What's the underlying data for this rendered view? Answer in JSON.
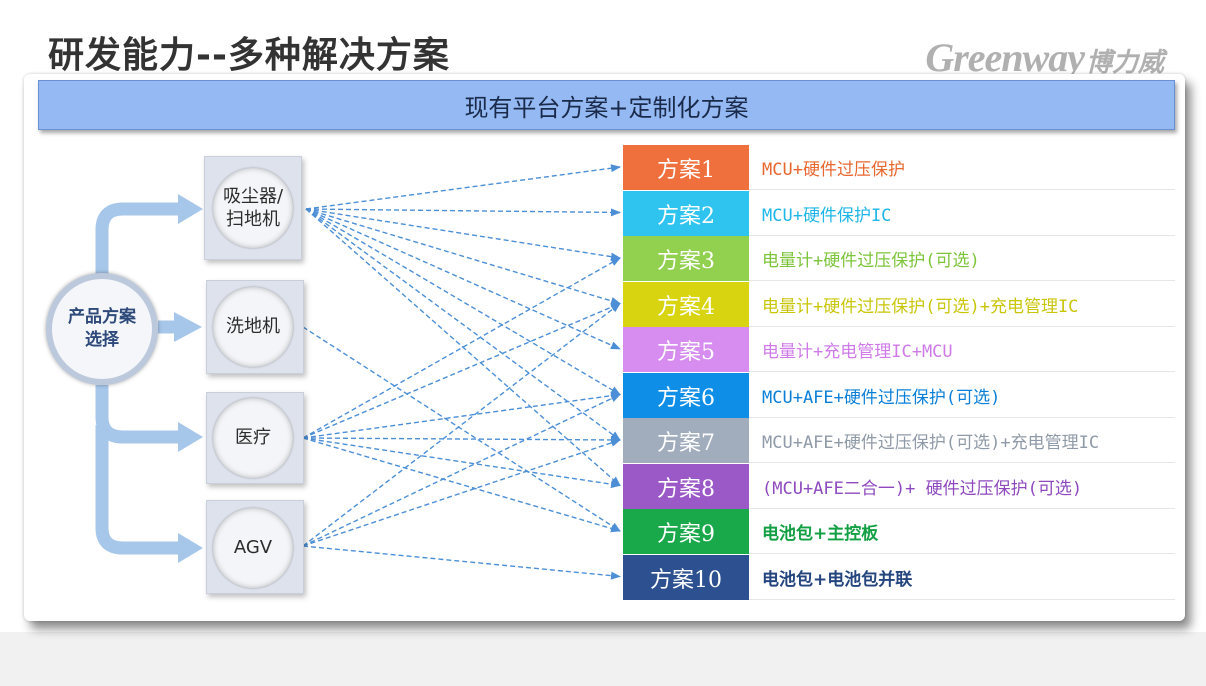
{
  "header": {
    "title": "研发能力--多种解决方案",
    "logo_latin": "Greenway",
    "logo_cn": "博力威"
  },
  "banner": {
    "text": "现有平台方案+定制化方案"
  },
  "root": {
    "line1": "产品方案",
    "line2": "选择"
  },
  "products": [
    {
      "id": "vacuum",
      "line1": "吸尘器/",
      "line2": "扫地机"
    },
    {
      "id": "floor-washer",
      "line1": "洗地机",
      "line2": ""
    },
    {
      "id": "medical",
      "line1": "医疗",
      "line2": ""
    },
    {
      "id": "agv",
      "line1": "AGV",
      "line2": ""
    }
  ],
  "schemes": [
    {
      "label": "方案1",
      "desc": "MCU+硬件过压保护",
      "bg": "#ef6f3d",
      "text_color": "#e8672f",
      "bold": false
    },
    {
      "label": "方案2",
      "desc": "MCU+硬件保护IC",
      "bg": "#2fc4f0",
      "text_color": "#1eb6e8",
      "bold": false
    },
    {
      "label": "方案3",
      "desc": "电量计+硬件过压保护(可选)",
      "bg": "#92d050",
      "text_color": "#7cc43a",
      "bold": false
    },
    {
      "label": "方案4",
      "desc": "电量计+硬件过压保护(可选)+充电管理IC",
      "bg": "#d8d410",
      "text_color": "#c9c60a",
      "bold": false
    },
    {
      "label": "方案5",
      "desc": "电量计+充电管理IC+MCU",
      "bg": "#d78cf0",
      "text_color": "#cf7ae8",
      "bold": false
    },
    {
      "label": "方案6",
      "desc": "MCU+AFE+硬件过压保护(可选)",
      "bg": "#0f8ee8",
      "text_color": "#0b7fd8",
      "bold": false
    },
    {
      "label": "方案7",
      "desc": "MCU+AFE+硬件过压保护(可选)+充电管理IC",
      "bg": "#a1adbd",
      "text_color": "#8f9aa8",
      "bold": false
    },
    {
      "label": "方案8",
      "desc": "(MCU+AFE二合一)+ 硬件过压保护(可选)",
      "bg": "#9b59c8",
      "text_color": "#8e49be",
      "bold": false
    },
    {
      "label": "方案9",
      "desc": "电池包+主控板",
      "bg": "#19a84a",
      "text_color": "#13a044",
      "bold": true
    },
    {
      "label": "方案10",
      "desc": "电池包+电池包并联",
      "bg": "#2d5190",
      "text_color": "#25457f",
      "bold": true
    }
  ],
  "connections": [
    {
      "from": "vacuum",
      "to": [
        1,
        2,
        3,
        4,
        5,
        6,
        7,
        8
      ]
    },
    {
      "from": "floor-washer",
      "to": [
        9
      ]
    },
    {
      "from": "medical",
      "to": [
        3,
        4,
        6,
        7,
        8,
        9
      ]
    },
    {
      "from": "agv",
      "to": [
        4,
        6,
        7,
        10
      ]
    }
  ],
  "colors": {
    "arrow_line": "#4d8fd6",
    "trunk": "#a7c7ea",
    "banner": "#95b9f3"
  }
}
